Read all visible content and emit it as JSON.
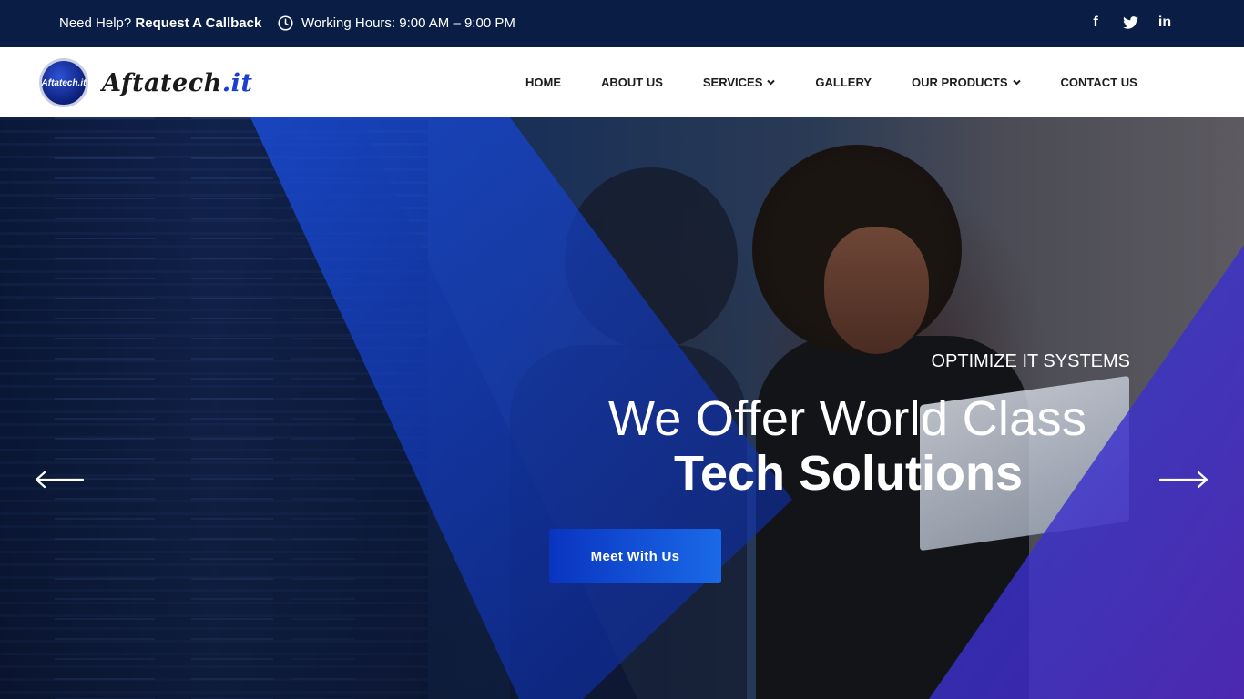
{
  "topbar": {
    "help_prefix": "Need Help?",
    "help_link": "Request A Callback",
    "hours": "Working Hours: 9:00 AM – 9:00 PM",
    "social": [
      {
        "icon": "facebook-icon",
        "glyph": "f"
      },
      {
        "icon": "twitter-icon",
        "glyph": ""
      },
      {
        "icon": "linkedin-icon",
        "glyph": "in"
      }
    ]
  },
  "header": {
    "logo_badge": "Aftatech.it",
    "logo_text": "Aftatech",
    "logo_dot": ".it",
    "nav": [
      {
        "label": "HOME",
        "dropdown": false
      },
      {
        "label": "ABOUT US",
        "dropdown": false
      },
      {
        "label": "SERVICES",
        "dropdown": true
      },
      {
        "label": "GALLERY",
        "dropdown": false
      },
      {
        "label": "OUR PRODUCTS",
        "dropdown": true
      },
      {
        "label": "CONTACT US",
        "dropdown": false
      }
    ]
  },
  "hero": {
    "kicker": "OPTIMIZE IT SYSTEMS",
    "headline_line1": "We Offer World Class",
    "headline_line2": "Tech Solutions",
    "cta_label": "Meet With Us"
  },
  "colors": {
    "topbar_bg": "#0a1e45",
    "accent_blue": "#1a4fe0",
    "cta_start": "#0a34c0",
    "cta_end": "#1a6ae8"
  }
}
